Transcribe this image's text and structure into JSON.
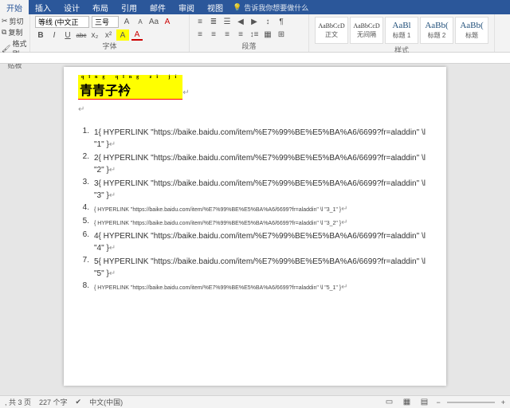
{
  "tabs": {
    "t0": "开始",
    "t1": "插入",
    "t2": "设计",
    "t3": "布局",
    "t4": "引用",
    "t5": "邮件",
    "t6": "审阅",
    "t7": "视图"
  },
  "tellme": "告诉我你想要做什么",
  "qat": {
    "cut": "剪切",
    "copy": "复制",
    "painter": "格式刷"
  },
  "groups": {
    "clipboard": "贴板",
    "font": "字体",
    "paragraph": "段落",
    "styles": "样式"
  },
  "font": {
    "name": "等线 (中文正",
    "size": "三号",
    "btns": {
      "grow": "A",
      "shrink": "A",
      "aa": "Aa",
      "clear": "A"
    },
    "row2": {
      "b": "B",
      "i": "I",
      "u": "U",
      "s": "abc",
      "sub": "x₂",
      "sup": "x²",
      "hl": "A",
      "fc": "A"
    }
  },
  "styles": [
    {
      "preview": "AaBbCcD",
      "name": "正文"
    },
    {
      "preview": "AaBbCcD",
      "name": "无间隔"
    },
    {
      "preview": "AaBl",
      "name": "标题 1"
    },
    {
      "preview": "AaBb(",
      "name": "标题 2"
    },
    {
      "preview": "AaBb(",
      "name": "标题"
    }
  ],
  "doc": {
    "title_ruby": "qīng qīng zǐ jí",
    "title": "青青子衿",
    "items": [
      {
        "n": "1.",
        "big": true,
        "text": "1{ HYPERLINK \"https://baike.baidu.com/item/%E7%99%BE%E5%BA%A6/6699?fr=aladdin\" \\l \"1\" }"
      },
      {
        "n": "2.",
        "big": true,
        "text": "2{ HYPERLINK \"https://baike.baidu.com/item/%E7%99%BE%E5%BA%A6/6699?fr=aladdin\" \\l \"2\" }"
      },
      {
        "n": "3.",
        "big": true,
        "text": "3{ HYPERLINK \"https://baike.baidu.com/item/%E7%99%BE%E5%BA%A6/6699?fr=aladdin\" \\l \"3\" }"
      },
      {
        "n": "4.",
        "big": false,
        "text": "{ HYPERLINK \"https://baike.baidu.com/item/%E7%99%BE%E5%BA%A6/6699?fr=aladdin\" \\l \"3_1\" }"
      },
      {
        "n": "5.",
        "big": false,
        "text": "{ HYPERLINK \"https://baike.baidu.com/item/%E7%99%BE%E5%BA%A6/6699?fr=aladdin\" \\l \"3_2\" }"
      },
      {
        "n": "6.",
        "big": true,
        "text": "4{ HYPERLINK \"https://baike.baidu.com/item/%E7%99%BE%E5%BA%A6/6699?fr=aladdin\" \\l \"4\" }"
      },
      {
        "n": "7.",
        "big": true,
        "text": "5{ HYPERLINK \"https://baike.baidu.com/item/%E7%99%BE%E5%BA%A6/6699?fr=aladdin\" \\l \"5\" }"
      },
      {
        "n": "8.",
        "big": false,
        "text": "{ HYPERLINK \"https://baike.baidu.com/item/%E7%99%BE%E5%BA%A6/6699?fr=aladdin\" \\l \"5_1\" }"
      }
    ]
  },
  "status": {
    "pages": ", 共 3 页",
    "words": "227 个字",
    "lang": "中文(中国)",
    "ime": "",
    "zoom_minus": "−",
    "zoom_plus": "+"
  }
}
